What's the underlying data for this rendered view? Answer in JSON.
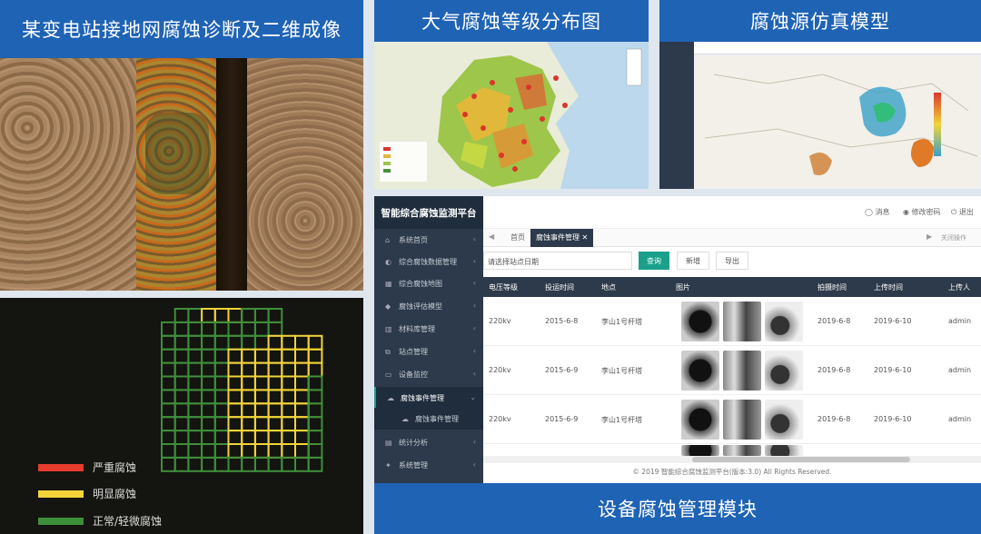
{
  "panels": {
    "top_left_title": "某变电站接地网腐蚀诊断及二维成像",
    "top_mid_title": "大气腐蚀等级分布图",
    "top_right_title": "腐蚀源仿真模型",
    "bottom_title": "设备腐蚀管理模块"
  },
  "legend": [
    {
      "label": "严重腐蚀",
      "color": "#e53c2e"
    },
    {
      "label": "明显腐蚀",
      "color": "#f2d43a"
    },
    {
      "label": "正常/轻微腐蚀",
      "color": "#3e8f3a"
    }
  ],
  "platform": {
    "title": "智能综合腐蚀监测平台",
    "header": {
      "message": "消息",
      "password": "修改密码",
      "logout": "退出"
    },
    "tabs": {
      "home": "首页",
      "active": "腐蚀事件管理",
      "tab_ops": "关闭操作"
    },
    "search": {
      "placeholder": "请选择站点日期",
      "query": "查询",
      "add": "新增",
      "export": "导出"
    },
    "menu": [
      {
        "label": "系统首页",
        "icon": "home-icon"
      },
      {
        "label": "综合腐蚀数据管理",
        "icon": "database-icon"
      },
      {
        "label": "综合腐蚀地图",
        "icon": "map-icon"
      },
      {
        "label": "腐蚀评估模型",
        "icon": "tag-icon"
      },
      {
        "label": "材料库管理",
        "icon": "bank-icon"
      },
      {
        "label": "站点管理",
        "icon": "sitemap-icon"
      },
      {
        "label": "设备监控",
        "icon": "monitor-icon"
      },
      {
        "label": "腐蚀事件管理",
        "icon": "cloud-icon"
      },
      {
        "label": "腐蚀事件管理",
        "icon": "cloud-icon"
      },
      {
        "label": "统计分析",
        "icon": "chart-icon"
      },
      {
        "label": "系统管理",
        "icon": "gear-icon"
      }
    ],
    "columns": [
      "电压等级",
      "投运时间",
      "地点",
      "图片",
      "拍摄时间",
      "上传时间",
      "上传人"
    ],
    "rows": [
      {
        "voltage": "220kv",
        "date": "2015-6-8",
        "place": "李山1号杆塔",
        "shot": "2019-6-8",
        "upload": "2019-6-10",
        "user": "admin"
      },
      {
        "voltage": "220kv",
        "date": "2015-6-9",
        "place": "李山1号杆塔",
        "shot": "2019-6-8",
        "upload": "2019-6-10",
        "user": "admin"
      },
      {
        "voltage": "220kv",
        "date": "2015-6-9",
        "place": "李山1号杆塔",
        "shot": "2019-6-8",
        "upload": "2019-6-10",
        "user": "admin"
      }
    ],
    "footer": "© 2019 智能综合腐蚀监测平台(版本:3.0) All Rights Reserved."
  }
}
